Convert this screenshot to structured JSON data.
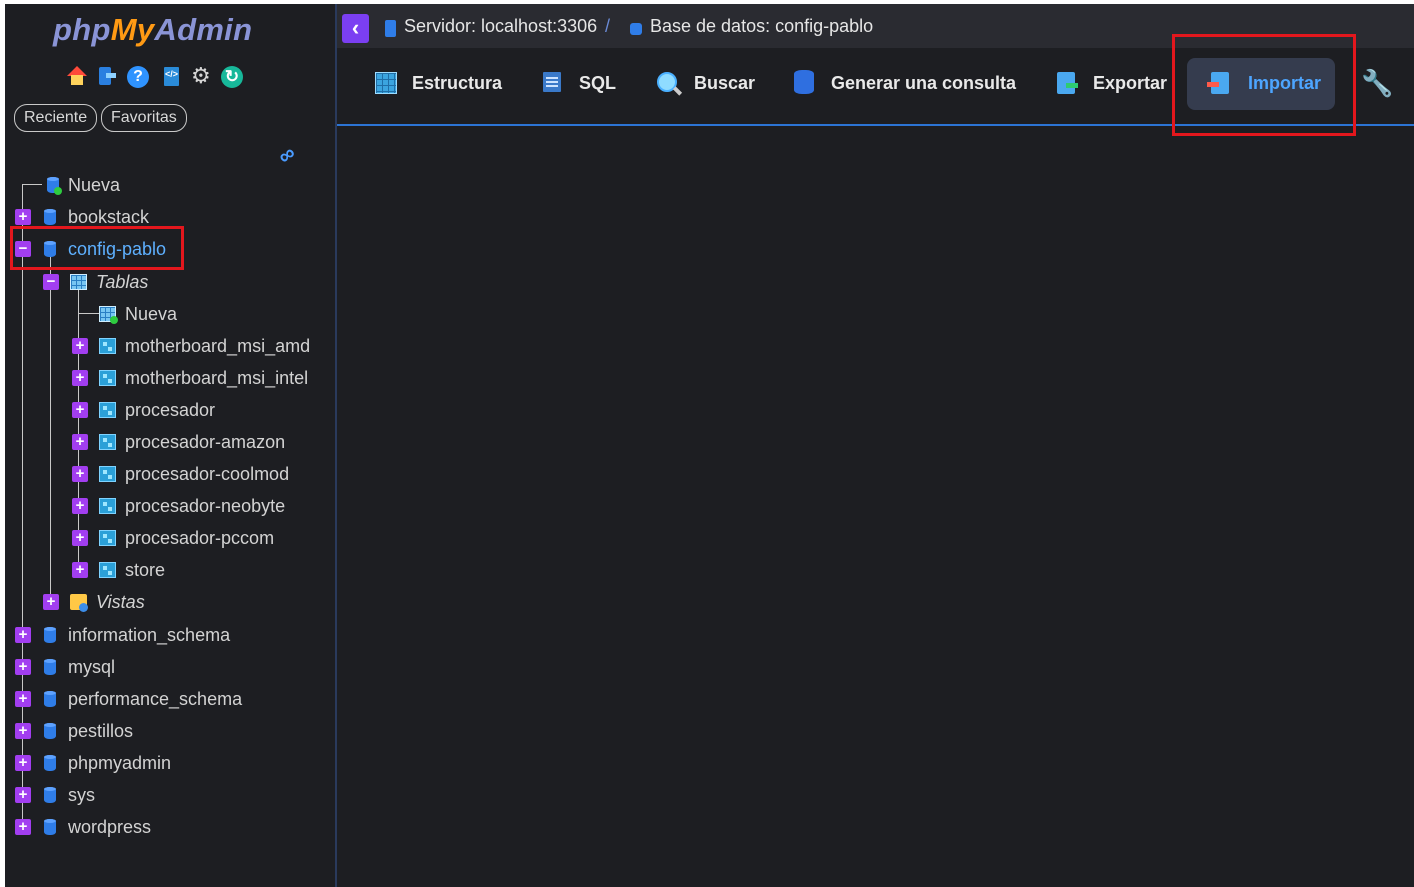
{
  "logo": {
    "part1": "php",
    "part2": "My",
    "part3": "Admin"
  },
  "quick_icons": [
    "home-icon",
    "logout-icon",
    "help-icon",
    "documentation-icon",
    "settings-gear-icon",
    "reload-icon"
  ],
  "sidebar": {
    "recent_label": "Reciente",
    "favorites_label": "Favoritas"
  },
  "tree": {
    "new_db": "Nueva",
    "databases_top": [
      {
        "name": "bookstack"
      }
    ],
    "selected_db": {
      "name": "config-pablo",
      "tables_group": "Tablas",
      "new_table": "Nueva",
      "tables": [
        "motherboard_msi_amd",
        "motherboard_msi_intel",
        "procesador",
        "procesador-amazon",
        "procesador-coolmod",
        "procesador-neobyte",
        "procesador-pccom",
        "store"
      ],
      "views_group": "Vistas"
    },
    "databases_bottom": [
      "information_schema",
      "mysql",
      "performance_schema",
      "pestillos",
      "phpmyadmin",
      "sys",
      "wordpress"
    ]
  },
  "breadcrumb": {
    "server": "Servidor: localhost:3306",
    "separator": "/",
    "database": "Base de datos: config-pablo"
  },
  "tabs": [
    {
      "label": "Estructura",
      "icon": "structure-icon"
    },
    {
      "label": "SQL",
      "icon": "sql-icon"
    },
    {
      "label": "Buscar",
      "icon": "search-icon"
    },
    {
      "label": "Generar una consulta",
      "icon": "query-icon"
    },
    {
      "label": "Exportar",
      "icon": "export-icon"
    },
    {
      "label": "Importar",
      "icon": "import-icon",
      "active": true
    },
    {
      "label": "",
      "icon": "wrench-icon"
    }
  ],
  "colors": {
    "background": "#1d1e22",
    "accent": "#4da5ff",
    "highlight": "#e3171d",
    "toggle": "#a23ef0"
  }
}
